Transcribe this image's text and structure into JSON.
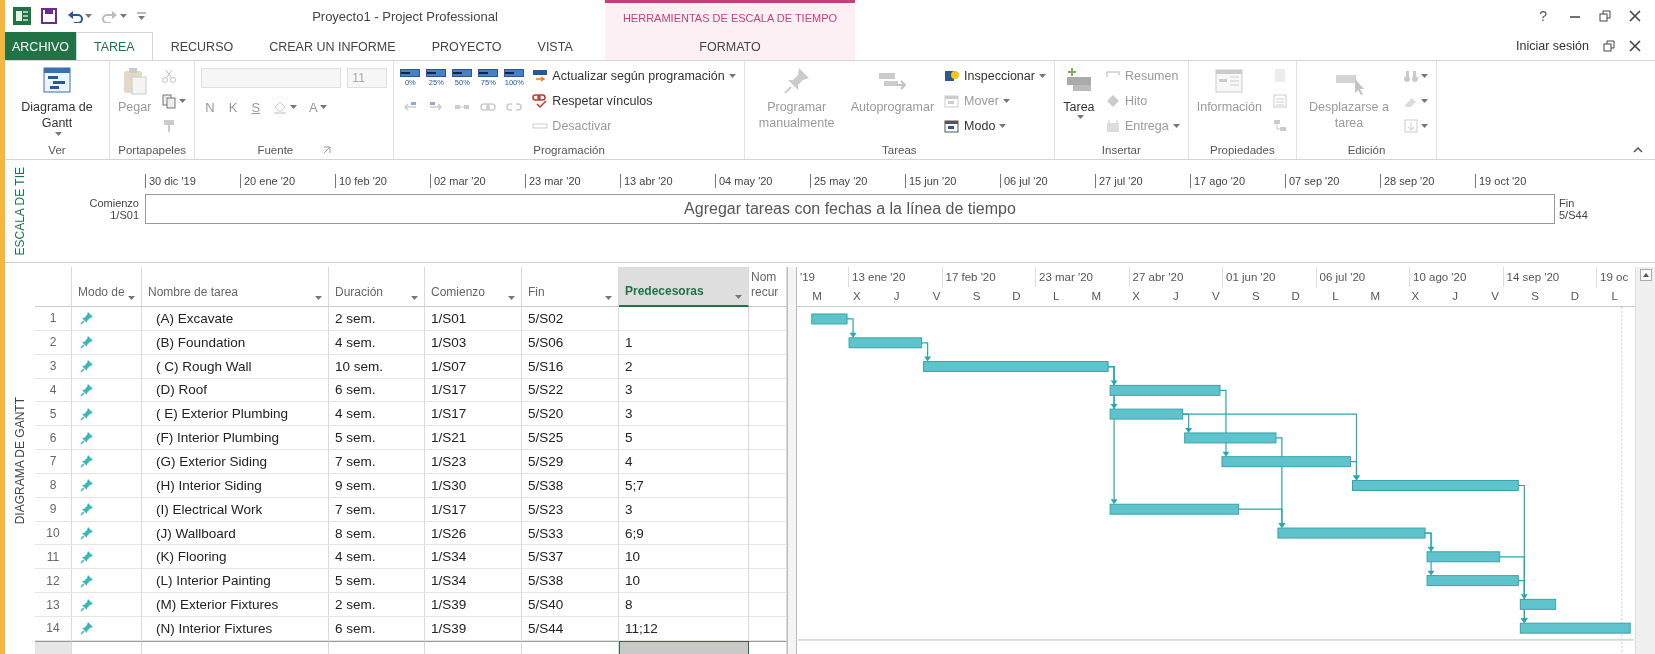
{
  "window": {
    "title": "Proyecto1 - Project Professional",
    "help": "?"
  },
  "contextual_tab_group": {
    "label": "HERRAMIENTAS DE ESCALA DE TIEMPO"
  },
  "tabs": [
    {
      "label": "ARCHIVO",
      "kind": "file",
      "selected": false
    },
    {
      "label": "TAREA",
      "kind": "tab",
      "selected": true
    },
    {
      "label": "RECURSO",
      "kind": "tab",
      "selected": false
    },
    {
      "label": "CREAR UN INFORME",
      "kind": "tab",
      "selected": false
    },
    {
      "label": "PROYECTO",
      "kind": "tab",
      "selected": false
    },
    {
      "label": "VISTA",
      "kind": "tab",
      "selected": false
    },
    {
      "label": "FORMATO",
      "kind": "contextual",
      "selected": false
    }
  ],
  "account": {
    "label": "Iniciar sesión"
  },
  "ribbon": {
    "groups": [
      {
        "label": "Ver",
        "launcher": false,
        "columns": [
          {
            "kind": "large",
            "items": [
              {
                "label": "Diagrama de Gantt",
                "dropdown": true,
                "disabled": false
              }
            ]
          }
        ]
      },
      {
        "label": "Portapapeles",
        "launcher": false,
        "columns": [
          {
            "kind": "large",
            "items": [
              {
                "label": "Pegar",
                "dropdown": false,
                "disabled": true
              }
            ]
          },
          {
            "kind": "icons",
            "items": [
              {
                "dropdown": false,
                "disabled": true
              },
              {
                "dropdown": true,
                "disabled": false
              },
              {
                "dropdown": false,
                "disabled": true
              }
            ]
          }
        ]
      },
      {
        "label": "Fuente",
        "launcher": true,
        "columns": [
          {
            "kind": "stack",
            "rows": [
              {
                "items": [
                  {
                    "kind": "field",
                    "wide": true,
                    "disabled": true
                  },
                  {
                    "kind": "field",
                    "value": "11",
                    "wide": false,
                    "disabled": true
                  }
                ]
              },
              {
                "items": [
                  {
                    "kind": "letter",
                    "label": "N",
                    "underline": false,
                    "dropdown": false,
                    "disabled": true
                  },
                  {
                    "kind": "letter",
                    "label": "K",
                    "underline": false,
                    "dropdown": false,
                    "disabled": true
                  },
                  {
                    "kind": "letter",
                    "label": "S",
                    "underline": true,
                    "dropdown": false,
                    "disabled": true
                  },
                  {
                    "kind": "icon",
                    "dropdown": true,
                    "disabled": true
                  },
                  {
                    "kind": "letter",
                    "label": "A",
                    "underline": false,
                    "dropdown": true,
                    "disabled": true
                  }
                ]
              }
            ]
          }
        ]
      },
      {
        "label": "Programación",
        "launcher": false,
        "columns": [
          {
            "kind": "stack",
            "rows": [
              {
                "items": [
                  {
                    "kind": "percent",
                    "label": "0%",
                    "disabled": false
                  },
                  {
                    "kind": "percent",
                    "label": "25%",
                    "disabled": false
                  },
                  {
                    "kind": "percent",
                    "label": "50%",
                    "disabled": false
                  },
                  {
                    "kind": "percent",
                    "label": "75%",
                    "disabled": false
                  },
                  {
                    "kind": "percent",
                    "label": "100%",
                    "disabled": false
                  }
                ]
              },
              {
                "items": [
                  {
                    "kind": "icon",
                    "dropdown": false,
                    "disabled": true
                  },
                  {
                    "kind": "icon",
                    "dropdown": false,
                    "disabled": true
                  },
                  {
                    "kind": "icon",
                    "dropdown": false,
                    "disabled": true
                  },
                  {
                    "kind": "icon",
                    "dropdown": false,
                    "disabled": true
                  },
                  {
                    "kind": "icon",
                    "dropdown": false,
                    "disabled": true
                  }
                ]
              }
            ]
          },
          {
            "kind": "small",
            "items": [
              {
                "label": "Actualizar según programación",
                "dropdown": true,
                "disabled": false
              },
              {
                "label": "Respetar vínculos",
                "dropdown": false,
                "disabled": false
              },
              {
                "label": "Desactivar",
                "dropdown": false,
                "disabled": true
              }
            ]
          }
        ]
      },
      {
        "label": "Tareas",
        "launcher": false,
        "columns": [
          {
            "kind": "large",
            "items": [
              {
                "label": "Programar manualmente",
                "dropdown": false,
                "disabled": true
              },
              {
                "label": "Autoprogramar",
                "dropdown": false,
                "disabled": true
              }
            ]
          },
          {
            "kind": "small",
            "items": [
              {
                "label": "Inspeccionar",
                "dropdown": true,
                "disabled": false
              },
              {
                "label": "Mover",
                "dropdown": true,
                "disabled": true
              },
              {
                "label": "Modo",
                "dropdown": true,
                "disabled": false
              }
            ]
          }
        ]
      },
      {
        "label": "Insertar",
        "launcher": false,
        "columns": [
          {
            "kind": "large",
            "items": [
              {
                "label": "Tarea",
                "dropdown": true,
                "disabled": false
              }
            ]
          },
          {
            "kind": "small",
            "items": [
              {
                "label": "Resumen",
                "dropdown": false,
                "disabled": true
              },
              {
                "label": "Hito",
                "dropdown": false,
                "disabled": true
              },
              {
                "label": "Entrega",
                "dropdown": true,
                "disabled": true
              }
            ]
          }
        ]
      },
      {
        "label": "Propiedades",
        "launcher": false,
        "columns": [
          {
            "kind": "large",
            "items": [
              {
                "label": "Información",
                "dropdown": false,
                "disabled": true
              }
            ]
          },
          {
            "kind": "icons",
            "items": [
              {
                "dropdown": false,
                "disabled": true
              },
              {
                "dropdown": false,
                "disabled": true
              },
              {
                "dropdown": false,
                "disabled": true
              }
            ]
          }
        ]
      },
      {
        "label": "Edición",
        "launcher": false,
        "columns": [
          {
            "kind": "large",
            "items": [
              {
                "label": "Desplazarse a tarea",
                "dropdown": false,
                "disabled": true
              }
            ]
          },
          {
            "kind": "icons",
            "items": [
              {
                "dropdown": true,
                "disabled": true
              },
              {
                "dropdown": true,
                "disabled": true
              },
              {
                "dropdown": true,
                "disabled": true
              }
            ]
          }
        ]
      }
    ]
  },
  "timeline": {
    "side_label": "ESCALA DE TIE",
    "start_label": "Comienzo",
    "start": "1/S01",
    "end_label": "Fin",
    "end": "5/S44",
    "placeholder": "Agregar tareas con fechas a la línea de tiempo",
    "dates": [
      "30 dic '19",
      "20 ene '20",
      "10 feb '20",
      "02 mar '20",
      "23 mar '20",
      "13 abr '20",
      "04 may '20",
      "25 may '20",
      "15 jun '20",
      "06 jul '20",
      "27 jul '20",
      "17 ago '20",
      "07 sep '20",
      "28 sep '20",
      "19 oct '20"
    ]
  },
  "gantt": {
    "side_label": "DIAGRAMA DE GANTT",
    "columns": [
      {
        "label": "Modo de",
        "dropdown": true,
        "selected": false
      },
      {
        "label": "Nombre de tarea",
        "dropdown": true,
        "selected": false
      },
      {
        "label": "Duración",
        "dropdown": true,
        "selected": false
      },
      {
        "label": "Comienzo",
        "dropdown": true,
        "selected": false
      },
      {
        "label": "Fin",
        "dropdown": true,
        "selected": false
      },
      {
        "label": "Predecesoras",
        "dropdown": true,
        "selected": true
      },
      {
        "label": "Nom recur",
        "dropdown": false,
        "selected": false
      }
    ],
    "rows": [
      {
        "id": "1",
        "name": "(A) Excavate",
        "duration": "2 sem.",
        "start": "1/S01",
        "finish": "5/S02"
      },
      {
        "id": "2",
        "name": "(B) Foundation",
        "duration": "4 sem.",
        "start": "1/S03",
        "finish": "5/S06",
        "predecessors": "1"
      },
      {
        "id": "3",
        "name": "( C) Rough Wall",
        "duration": "10 sem.",
        "start": "1/S07",
        "finish": "5/S16",
        "predecessors": "2"
      },
      {
        "id": "4",
        "name": "(D) Roof",
        "duration": "6 sem.",
        "start": "1/S17",
        "finish": "5/S22",
        "predecessors": "3"
      },
      {
        "id": "5",
        "name": "( E) Exterior Plumbing",
        "duration": "4 sem.",
        "start": "1/S17",
        "finish": "5/S20",
        "predecessors": "3"
      },
      {
        "id": "6",
        "name": "(F) Interior Plumbing",
        "duration": "5 sem.",
        "start": "1/S21",
        "finish": "5/S25",
        "predecessors": "5"
      },
      {
        "id": "7",
        "name": "(G) Exterior Siding",
        "duration": "7 sem.",
        "start": "1/S23",
        "finish": "5/S29",
        "predecessors": "4"
      },
      {
        "id": "8",
        "name": "(H) Interior Siding",
        "duration": "9 sem.",
        "start": "1/S30",
        "finish": "5/S38",
        "predecessors": "5;7"
      },
      {
        "id": "9",
        "name": "(I) Electrical Work",
        "duration": "7 sem.",
        "start": "1/S17",
        "finish": "5/S23",
        "predecessors": "3"
      },
      {
        "id": "10",
        "name": "(J) Wallboard",
        "duration": "8 sem.",
        "start": "1/S26",
        "finish": "5/S33",
        "predecessors": "6;9"
      },
      {
        "id": "11",
        "name": "(K) Flooring",
        "duration": "4 sem.",
        "start": "1/S34",
        "finish": "5/S37",
        "predecessors": "10"
      },
      {
        "id": "12",
        "name": "(L) Interior Painting",
        "duration": "5 sem.",
        "start": "1/S34",
        "finish": "5/S38",
        "predecessors": "10"
      },
      {
        "id": "13",
        "name": "(M) Exterior Fixtures",
        "duration": "2 sem.",
        "start": "1/S39",
        "finish": "5/S40",
        "predecessors": "8"
      },
      {
        "id": "14",
        "name": "(N) Interior Fixtures",
        "duration": "6 sem.",
        "start": "1/S39",
        "finish": "5/S44",
        "predecessors": "11;12"
      }
    ],
    "timescale": {
      "top": [
        "'19",
        "13 ene '20",
        "17 feb '20",
        "23 mar '20",
        "27 abr '20",
        "01 jun '20",
        "06 jul '20",
        "10 ago '20",
        "14 sep '20",
        "19 oc"
      ],
      "bottom": [
        "M",
        "X",
        "J",
        "V",
        "S",
        "D",
        "L",
        "M",
        "X",
        "J",
        "V",
        "S",
        "D",
        "L",
        "M",
        "X",
        "J",
        "V",
        "S",
        "D",
        "L"
      ]
    }
  }
}
